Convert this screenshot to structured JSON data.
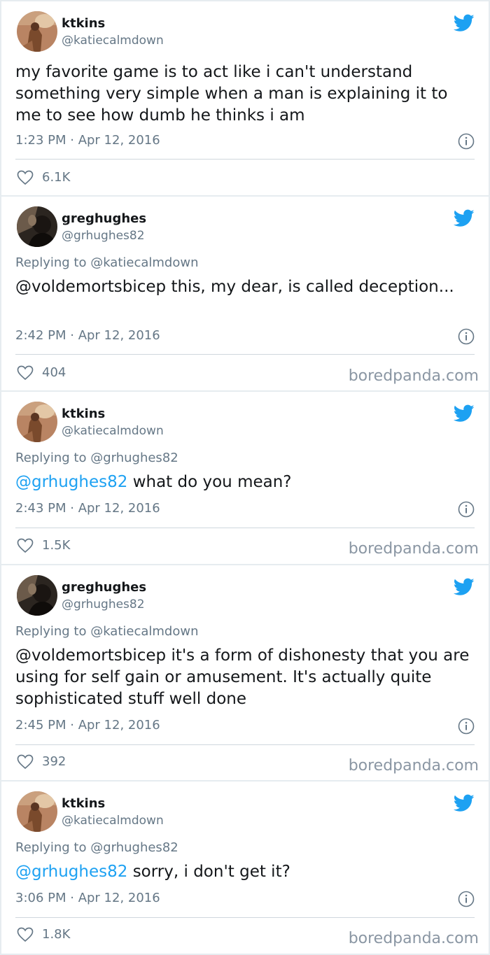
{
  "colors": {
    "twitter_blue": "#1da1f2",
    "text_primary": "#14171a",
    "text_secondary": "#657786",
    "watermark": "#8a96a3"
  },
  "watermark_text": "boredpanda.com",
  "tweets": [
    {
      "name": "ktkins",
      "handle": "@katiecalmdown",
      "avatar": "ktkins-avatar",
      "reply_to": "",
      "mention": "",
      "text": "my favorite game is to act like i can't understand something very simple when a man is explaining it to me to see how dumb he thinks i am",
      "timestamp": "1:23 PM · Apr 12, 2016",
      "likes": "6.1K",
      "show_watermark": false
    },
    {
      "name": "greghughes",
      "handle": "@grhughes82",
      "avatar": "greghughes-avatar",
      "reply_to": "Replying to @katiecalmdown",
      "mention": "",
      "text": "@voldemortsbicep this, my dear, is called deception...",
      "timestamp": "2:42 PM · Apr 12, 2016",
      "likes": "404",
      "show_watermark": true
    },
    {
      "name": "ktkins",
      "handle": "@katiecalmdown",
      "avatar": "ktkins-avatar",
      "reply_to": "Replying to @grhughes82",
      "mention": "@grhughes82",
      "text": " what do you mean?",
      "timestamp": "2:43 PM · Apr 12, 2016",
      "likes": "1.5K",
      "show_watermark": true
    },
    {
      "name": "greghughes",
      "handle": "@grhughes82",
      "avatar": "greghughes-avatar",
      "reply_to": "Replying to @katiecalmdown",
      "mention": "",
      "text": "@voldemortsbicep it's a form of dishonesty that you are using for self gain or amusement. It's actually quite sophisticated stuff well done",
      "timestamp": "2:45 PM · Apr 12, 2016",
      "likes": "392",
      "show_watermark": true
    },
    {
      "name": "ktkins",
      "handle": "@katiecalmdown",
      "avatar": "ktkins-avatar",
      "reply_to": "Replying to @grhughes82",
      "mention": "@grhughes82",
      "text": " sorry, i don't get it?",
      "timestamp": "3:06 PM · Apr 12, 2016",
      "likes": "1.8K",
      "show_watermark": true
    }
  ]
}
